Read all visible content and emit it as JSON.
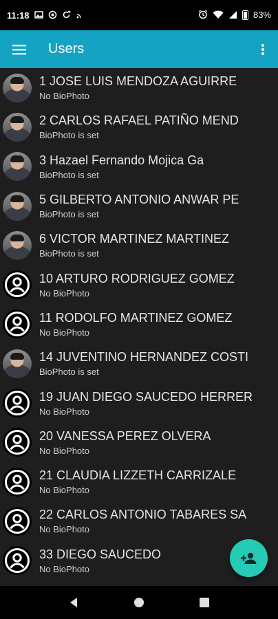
{
  "status_bar": {
    "time": "11:18",
    "battery": "83%",
    "left_icons": [
      "gallery-icon",
      "app-icon",
      "sync-icon",
      "cast-icon"
    ],
    "right_icons": [
      "alarm-icon",
      "wifi-icon",
      "signal-icon",
      "battery-icon"
    ]
  },
  "app_bar": {
    "title": "Users",
    "menu_icon": "hamburger-menu-icon",
    "overflow_icon": "more-vert-icon",
    "color": "#14a3c2"
  },
  "users": [
    {
      "name": "1 JOSE LUIS MENDOZA AGUIRRE",
      "status": "No BioPhoto",
      "avatar": "photo"
    },
    {
      "name": "2 CARLOS RAFAEL PATIÑO MEND",
      "status": "BioPhoto is set",
      "avatar": "photo"
    },
    {
      "name": "3 Hazael Fernando Mojica Ga",
      "status": "BioPhoto is set",
      "avatar": "photo"
    },
    {
      "name": "5 GILBERTO ANTONIO ANWAR PE",
      "status": "BioPhoto is set",
      "avatar": "photo"
    },
    {
      "name": "6 VICTOR MARTINEZ MARTINEZ",
      "status": "BioPhoto is set",
      "avatar": "photo"
    },
    {
      "name": "10 ARTURO RODRIGUEZ GOMEZ",
      "status": "No BioPhoto",
      "avatar": "placeholder"
    },
    {
      "name": "11 RODOLFO MARTINEZ GOMEZ",
      "status": "No BioPhoto",
      "avatar": "placeholder"
    },
    {
      "name": "14 JUVENTINO HERNANDEZ COSTI",
      "status": "BioPhoto is set",
      "avatar": "photo"
    },
    {
      "name": "19 JUAN DIEGO SAUCEDO HERRER",
      "status": "No BioPhoto",
      "avatar": "placeholder"
    },
    {
      "name": "20 VANESSA PEREZ OLVERA",
      "status": "No BioPhoto",
      "avatar": "placeholder"
    },
    {
      "name": "21 CLAUDIA LIZZETH CARRIZALE",
      "status": "No BioPhoto",
      "avatar": "placeholder"
    },
    {
      "name": "22 CARLOS ANTONIO TABARES SA",
      "status": "No BioPhoto",
      "avatar": "placeholder"
    },
    {
      "name": "33 DIEGO SAUCEDO",
      "status": "No BioPhoto",
      "avatar": "placeholder"
    }
  ],
  "fab": {
    "icon": "add-user-icon",
    "color": "#25cbb4"
  },
  "nav_bar": {
    "icons": [
      "back-icon",
      "home-icon",
      "recents-icon"
    ]
  }
}
